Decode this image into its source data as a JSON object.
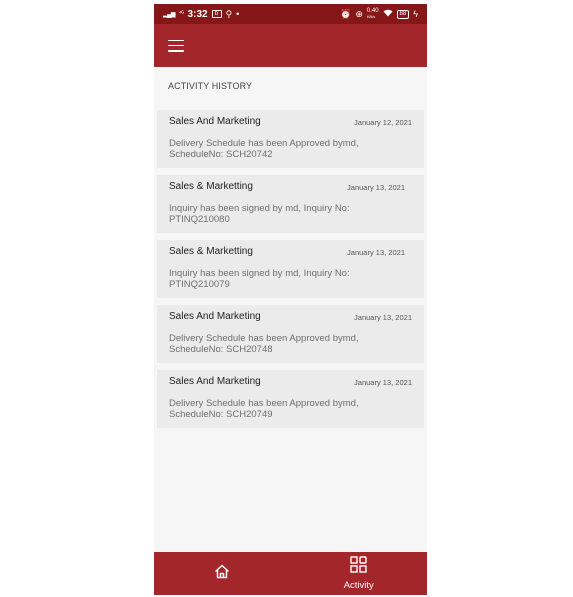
{
  "status_bar": {
    "network_left": "⁴ᴳ",
    "time": "3:32",
    "app_badge": "b",
    "usb": "⚲",
    "dot": "•",
    "speed": "0.40",
    "speed_unit": "KB/s",
    "battery": "88"
  },
  "section": {
    "title": "ACTIVITY HISTORY"
  },
  "activities": [
    {
      "title": "Sales And Marketing",
      "date": "January 12, 2021",
      "line1": "Delivery Schedule has been Approved bymd,",
      "line2": "ScheduleNo: SCH20742"
    },
    {
      "title": "Sales & Marketting",
      "date": "January 13, 2021",
      "line1": "Inquiry  has been signed by md, Inquiry No:",
      "line2": "PTINQ210080"
    },
    {
      "title": "Sales & Marketting",
      "date": "January 13, 2021",
      "line1": "Inquiry  has been signed by md, Inquiry No:",
      "line2": "PTINQ210079"
    },
    {
      "title": "Sales And Marketing",
      "date": "January 13, 2021",
      "line1": "Delivery Schedule has been Approved bymd,",
      "line2": "ScheduleNo: SCH20748"
    },
    {
      "title": "Sales And Marketing",
      "date": "January 13, 2021",
      "line1": "Delivery Schedule has been Approved bymd,",
      "line2": "ScheduleNo: SCH20749"
    }
  ],
  "bottom_nav": {
    "home": {
      "icon": "home-icon"
    },
    "activity": {
      "icon": "grid-icon",
      "label": "Activity"
    }
  },
  "colors": {
    "status_bar": "#861718",
    "primary": "#a3262a",
    "card": "#ebebeb",
    "background": "#f6f6f6"
  }
}
